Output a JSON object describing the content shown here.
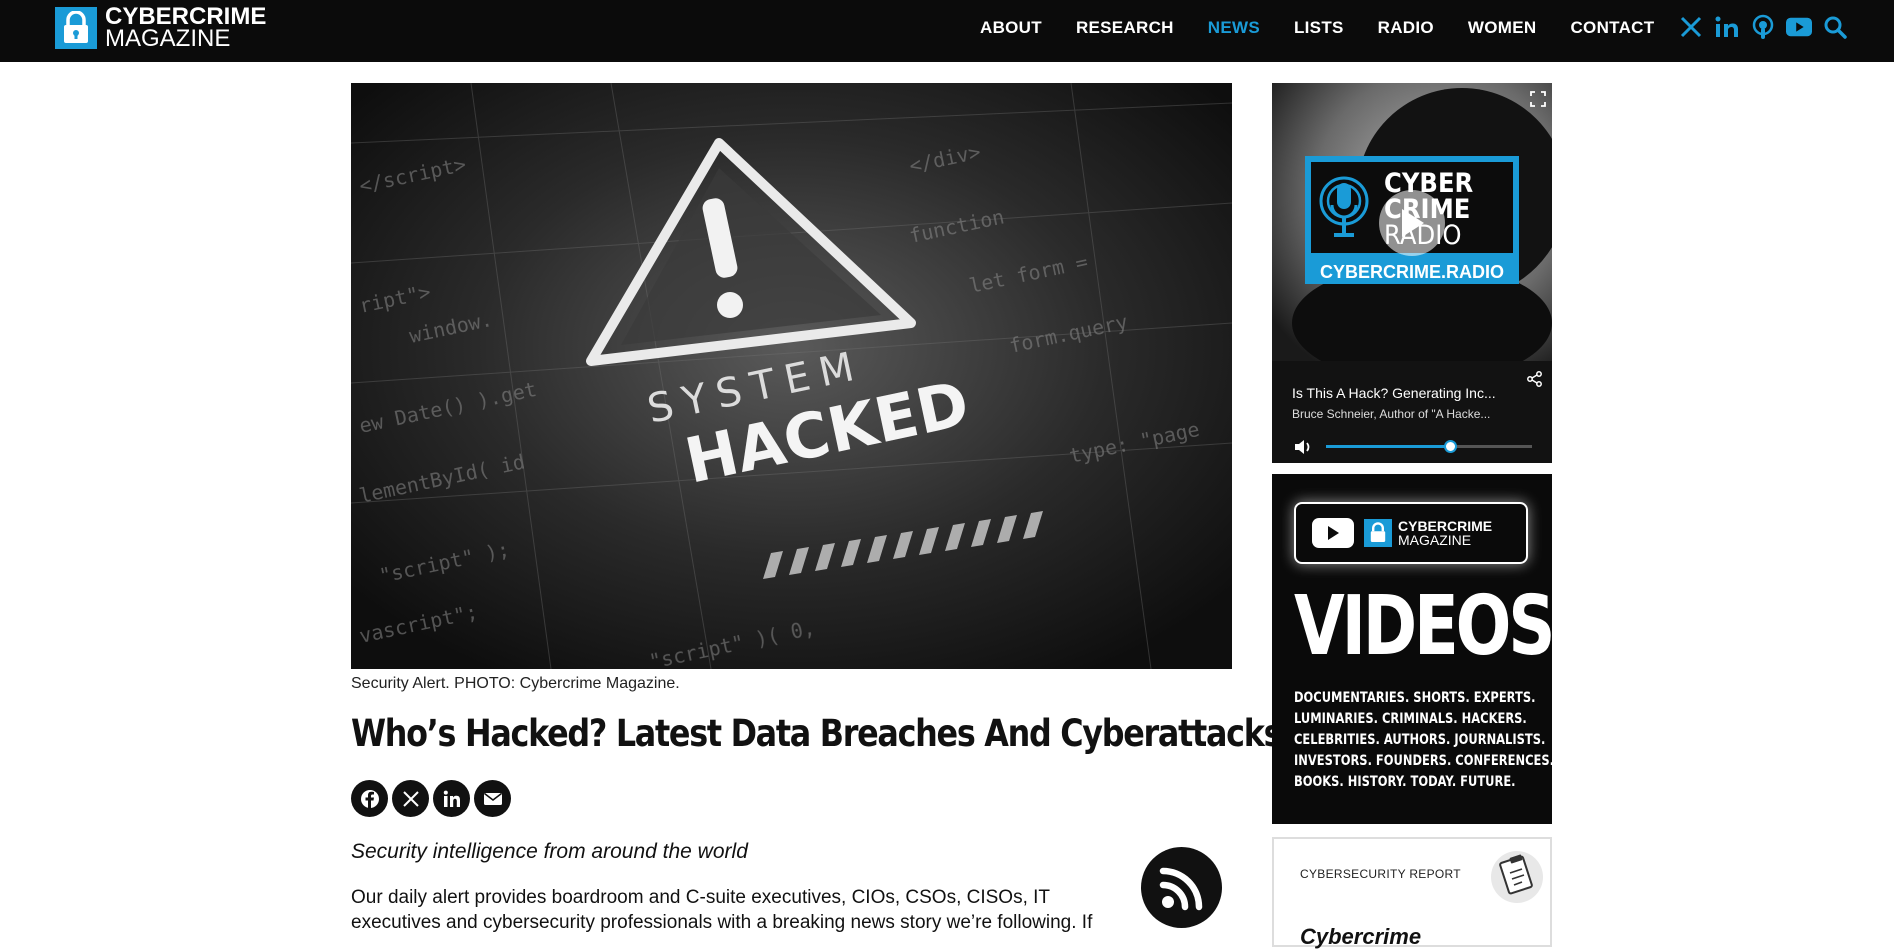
{
  "header": {
    "logo_line1": "CYBERCRIME",
    "logo_line2": "MAGAZINE",
    "nav": [
      "ABOUT",
      "RESEARCH",
      "NEWS",
      "LISTS",
      "RADIO",
      "WOMEN",
      "CONTACT"
    ],
    "active_nav": "NEWS",
    "social_icons": [
      "x-icon",
      "linkedin-icon",
      "podcast-icon",
      "youtube-icon",
      "search-icon"
    ]
  },
  "article": {
    "hero_text_line1": "SYSTEM",
    "hero_text_line2": "HACKED",
    "caption": "Security Alert. PHOTO: Cybercrime Magazine.",
    "title": "Who’s Hacked? Latest Data Breaches And Cyberattacks",
    "share_icons": [
      "facebook-icon",
      "x-icon",
      "linkedin-icon",
      "email-icon"
    ],
    "subtitle": "Security intelligence from around the world",
    "body_line1": "Our daily alert provides boardroom and C-suite executives, CIOs, CSOs, CISOs, IT",
    "body_line2": "executives and cybersecurity professionals with a breaking news story we’re following. If"
  },
  "radio_player": {
    "logo_line1": "CYBER",
    "logo_line2": "CRIME",
    "logo_line3": "RADIO",
    "logo_url_text": "CYBERCRIME.RADIO",
    "episode_title": "Is This A Hack? Generating Inc...",
    "episode_author": "Bruce Schneier, Author of \"A Hacke...",
    "volume_level": 0.6
  },
  "videos_ad": {
    "logo_line1": "CYBERCRIME",
    "logo_line2": "MAGAZINE",
    "title": "VIDEOS.",
    "lines": [
      "DOCUMENTARIES. SHORTS. EXPERTS.",
      "LUMINARIES. CRIMINALS. HACKERS.",
      "CELEBRITIES. AUTHORS. JOURNALISTS.",
      "INVESTORS. FOUNDERS. CONFERENCES.",
      "BOOKS. HISTORY. TODAY. FUTURE."
    ]
  },
  "report_ad": {
    "label": "CYBERSECURITY REPORT",
    "title": "Cybercrime"
  },
  "colors": {
    "brand_blue": "#1a9bd7",
    "header_bg": "#0b0b0b"
  }
}
